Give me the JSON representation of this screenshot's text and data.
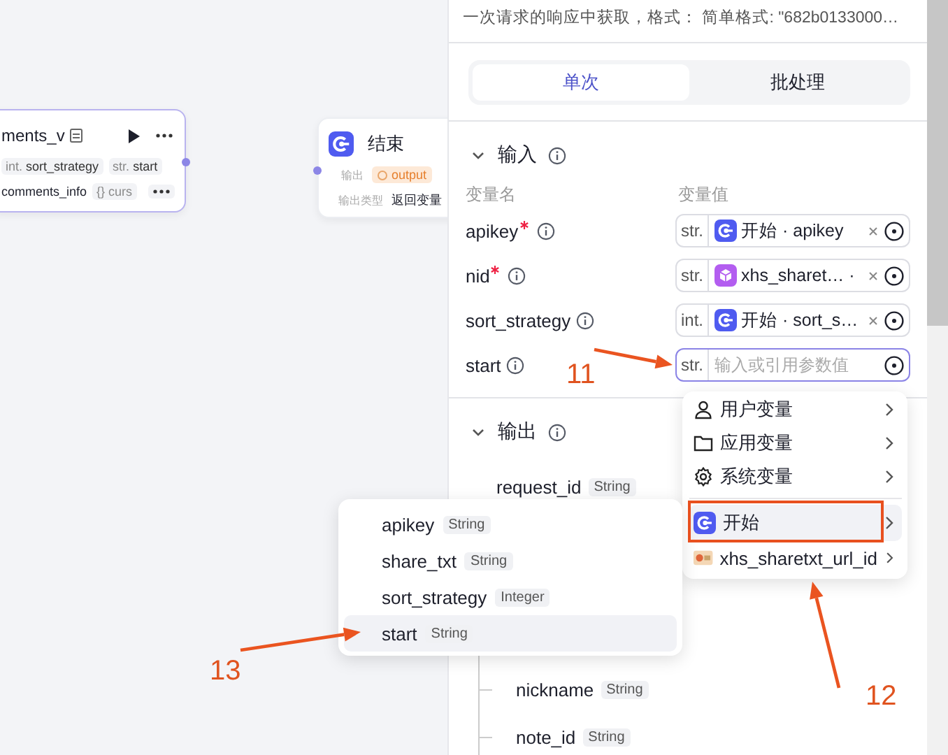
{
  "canvas": {
    "nodes": [
      {
        "kind": "tool",
        "title": "ments_v",
        "inputs": [
          {
            "type": "int.",
            "name": "sort_strategy"
          },
          {
            "type": "str.",
            "name": "start"
          }
        ],
        "outputs": [
          {
            "name": "comments_info",
            "tag": "{} curs"
          }
        ]
      },
      {
        "kind": "end",
        "title": "结束",
        "rows": [
          {
            "label": "输出",
            "value": "output",
            "kind": "tag"
          },
          {
            "label": "输出类型",
            "value": "返回变量",
            "kind": "text"
          }
        ]
      }
    ]
  },
  "panel": {
    "description": "一次请求的响应中获取，格式： 简单格式: \"682b0133000…",
    "modes": [
      {
        "label": "单次",
        "selected": true
      },
      {
        "label": "批处理",
        "selected": false
      }
    ],
    "input": {
      "title": "输入",
      "col_name": "变量名",
      "col_value": "变量值",
      "params": [
        {
          "name": "apikey",
          "required": true,
          "type": "str.",
          "kind": "start_ref",
          "value": "开始 · apikey"
        },
        {
          "name": "nid",
          "required": true,
          "type": "str.",
          "kind": "plugin_ref",
          "value": "xhs_sharet… ·"
        },
        {
          "name": "sort_strategy",
          "required": false,
          "type": "int.",
          "kind": "start_ref",
          "value": "开始 · sort_s…"
        },
        {
          "name": "start",
          "required": false,
          "type": "str.",
          "kind": "input",
          "placeholder": "输入或引用参数值",
          "focused": true
        }
      ]
    },
    "output": {
      "title": "输出",
      "fields": [
        {
          "name": "request_id",
          "type": "String",
          "kind": "top"
        },
        {
          "name": "nickname",
          "type": "String",
          "kind": "child"
        },
        {
          "name": "note_id",
          "type": "String",
          "kind": "child"
        }
      ]
    }
  },
  "ref_menu": {
    "items": [
      {
        "label": "用户变量",
        "kind": "user",
        "selected": false
      },
      {
        "label": "应用变量",
        "kind": "folder",
        "selected": false
      },
      {
        "label": "系统变量",
        "kind": "gear",
        "selected": false
      },
      {
        "label": "开始",
        "kind": "start",
        "selected": true
      },
      {
        "label": "xhs_sharetxt_url_id",
        "kind": "plugin",
        "selected": false
      }
    ]
  },
  "field_menu": {
    "items": [
      {
        "name": "apikey",
        "type": "String",
        "selected": false
      },
      {
        "name": "share_txt",
        "type": "String",
        "selected": false
      },
      {
        "name": "sort_strategy",
        "type": "Integer",
        "selected": false
      },
      {
        "name": "start",
        "type": "String",
        "selected": true
      }
    ]
  },
  "annotations": [
    {
      "label": "11"
    },
    {
      "label": "12"
    },
    {
      "label": "13"
    }
  ]
}
